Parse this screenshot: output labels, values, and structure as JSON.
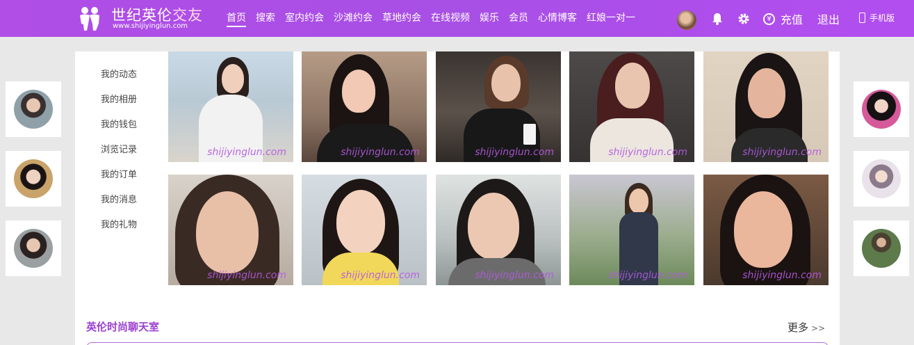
{
  "header": {
    "logo_text_main": "世纪英伦",
    "logo_text_accent": "交友",
    "logo_url": "www.shijiyinglun.com",
    "nav": [
      {
        "label": "首页",
        "active": true
      },
      {
        "label": "搜索"
      },
      {
        "label": "室内约会"
      },
      {
        "label": "沙滩约会"
      },
      {
        "label": "草地约会"
      },
      {
        "label": "在线视频"
      },
      {
        "label": "娱乐"
      },
      {
        "label": "会员"
      },
      {
        "label": "心情博客"
      },
      {
        "label": "红娘一对一"
      }
    ],
    "recharge_label": "充值",
    "recharge_icon": "¥",
    "logout_label": "退出",
    "mobile_label": "手机版"
  },
  "side_menu": {
    "items": [
      "我的动态",
      "我的相册",
      "我的钱包",
      "浏览记录",
      "我的订单",
      "我的消息",
      "我的礼物"
    ]
  },
  "photos": {
    "watermark": "shijiyinglun.com",
    "count": 10
  },
  "chatroom": {
    "title": "英伦时尚聊天室",
    "more_label": "更多",
    "more_arrow": ">>"
  },
  "colors": {
    "header_gradient": "#a84fe6",
    "accent_purple": "#9a3fd1",
    "watermark": "#b35adf"
  }
}
